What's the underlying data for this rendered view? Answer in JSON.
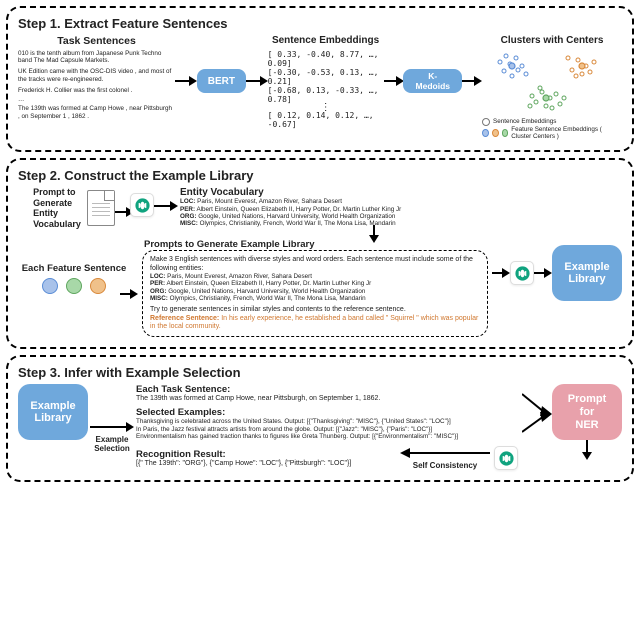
{
  "step1": {
    "title": "Step 1. Extract Feature Sentences",
    "cols": {
      "task": "Task Sentences",
      "embed": "Sentence Embeddings",
      "clusters": "Clusters with Centers"
    },
    "sentences": {
      "s1": "010 is the tenth album from Japanese Punk Techno band The Mad Capsule Markets.",
      "s2": "UK Edition came with the OSC-DIS video , and most of the tracks were re-engineered.",
      "s3": "Frederick H. Collier was the first colonel .",
      "s4": "The 139th was formed at Camp Howe , near Pittsburgh , on September 1 , 1862 .",
      "ellipsis": "…"
    },
    "embeddings": {
      "e1": "[ 0.33, -0.40, 8.77, …, 0.09]",
      "e2": "[-0.30, -0.53, 0.13, …, 0.21]",
      "e3": "[-0.68,  0.13, -0.33, …, 0.78]",
      "e4": "[ 0.12,  0.14,  0.12, …, -0.67]",
      "vdots": "⋮"
    },
    "bert": "BERT",
    "kmed": "K-Medoids",
    "legend": {
      "se": "Sentence Embeddings",
      "fse": "Feature Sentence Embeddings  ( Cluster Centers )"
    }
  },
  "step2": {
    "title": "Step 2. Construct the Example Library",
    "prompt_gen_vocab": "Prompt to\nGenerate\nEntity\nVocabulary",
    "each_feature": "Each Feature Sentence",
    "entity_vocab": {
      "title": "Entity Vocabulary",
      "loc": "LOC: Paris, Mount Everest, Amazon River, Sahara Desert",
      "per": "PER: Albert Einstein, Queen Elizabeth II, Harry Potter, Dr. Martin Luther King Jr",
      "org": "ORG: Google, United Nations, Harvard University, World Health Organization",
      "misc": "MISC: Olympics, Christianity, French, World War II, The Mona Lisa, Mandarin"
    },
    "promptbox": {
      "title": "Prompts to Generate Example Library",
      "l1": "Make 3 English sentences with diverse styles and word orders. Each sentence must include some of the following entities:",
      "l2": "LOC: Paris, Mount Everest, Amazon River, Sahara Desert",
      "l3": "PER: Albert Einstein, Queen Elizabeth II, Harry Potter, Dr. Martin Luther King Jr",
      "l4": "ORG: Google, United Nations, Harvard University, World Health Organization",
      "l5": "MISC: Olympics, Christianity, French, World War II, The Mona Lisa, Mandarin",
      "l6": "Try to generate sentences in similar styles and contents to the reference sentence.",
      "ref_label": "Reference Sentence: ",
      "ref_text": "In his early experience, he established a band called \" Squirrel \" which was popular in the local community."
    },
    "example_library": "Example\nLibrary"
  },
  "step3": {
    "title": "Step 3. Infer with Example Selection",
    "example_library": "Example\nLibrary",
    "example_selection": "Example\nSelection",
    "each_task_label": "Each Task Sentence:",
    "each_task": "The 139th was formed at Camp Howe, near Pittsburgh, on September 1, 1862.",
    "selected_label": "Selected Examples:",
    "sel1": "Thanksgiving is celebrated across the United States. Output: [{\"Thanksgiving\": \"MISC\"}, {\"United States\": \"LOC\"}]",
    "sel2": "In Paris, the Jazz festival attracts artists from around the globe. Output: [{\"Jazz\": \"MISC\"}, {\"Paris\": \"LOC\"}]",
    "sel3": "Environmentalism has gained traction thanks to figures like Greta Thunberg. Output: [{\"Environmentalism\": \"MISC\"}]",
    "prompt_ner": "Prompt\nfor\nNER",
    "recog_label": "Recognition Result:",
    "recog": "[{\" The 139th\": \"ORG\"}, {\"Camp Howe\": \"LOC\"}, {\"Pittsburgh\": \"LOC\"}]",
    "self_consistency": "Self Consistency"
  }
}
